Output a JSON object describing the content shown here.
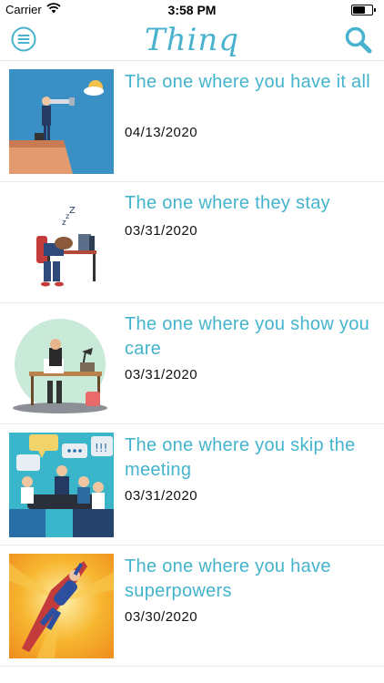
{
  "status": {
    "carrier": "Carrier",
    "time": "3:58 PM",
    "battery_level": 0.65
  },
  "nav": {
    "title": "Thinq"
  },
  "items": [
    {
      "title": "The one where you have it all",
      "date": "04/13/2020"
    },
    {
      "title": "The one where they stay",
      "date": "03/31/2020"
    },
    {
      "title": "The one where you show you care",
      "date": "03/31/2020"
    },
    {
      "title": "The one where you skip the meeting",
      "date": "03/31/2020"
    },
    {
      "title": "The one where you have superpowers",
      "date": "03/30/2020"
    }
  ],
  "colors": {
    "accent": "#48b2cf",
    "divider": "#e8e8e8"
  }
}
